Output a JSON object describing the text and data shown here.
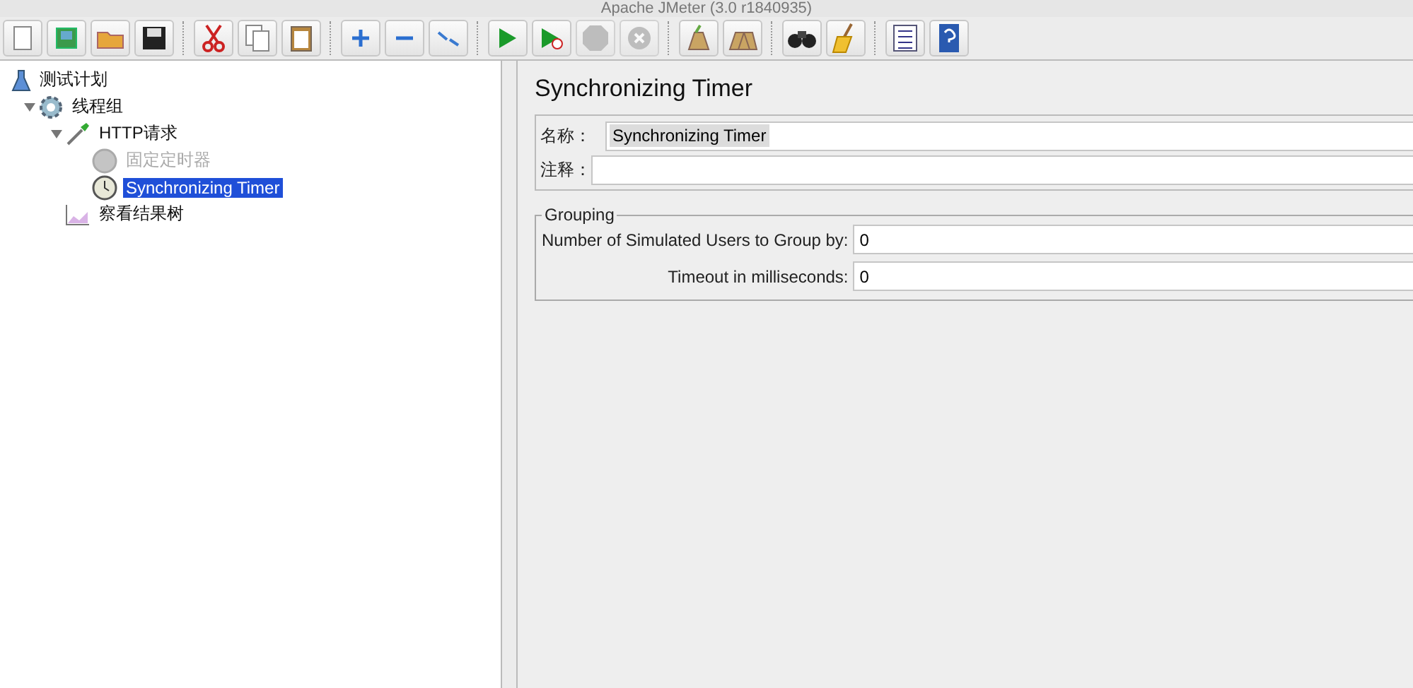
{
  "window": {
    "title": "Apache JMeter (3.0 r1840935)"
  },
  "toolbar": [
    {
      "kind": "new",
      "disabled": false
    },
    {
      "kind": "templates",
      "disabled": false
    },
    {
      "kind": "open",
      "disabled": false
    },
    {
      "kind": "save",
      "disabled": false
    },
    {
      "kind": "sep"
    },
    {
      "kind": "cut",
      "disabled": false
    },
    {
      "kind": "copy",
      "disabled": false
    },
    {
      "kind": "paste",
      "disabled": false
    },
    {
      "kind": "sep"
    },
    {
      "kind": "expand",
      "disabled": false
    },
    {
      "kind": "collapse",
      "disabled": false
    },
    {
      "kind": "toggle",
      "disabled": false
    },
    {
      "kind": "sep"
    },
    {
      "kind": "start",
      "disabled": false
    },
    {
      "kind": "start-no-pause",
      "disabled": false
    },
    {
      "kind": "stop",
      "disabled": true
    },
    {
      "kind": "shutdown",
      "disabled": true
    },
    {
      "kind": "sep"
    },
    {
      "kind": "clear",
      "disabled": false
    },
    {
      "kind": "clear-all",
      "disabled": false
    },
    {
      "kind": "sep"
    },
    {
      "kind": "search",
      "disabled": false
    },
    {
      "kind": "reset-search",
      "disabled": false
    },
    {
      "kind": "sep"
    },
    {
      "kind": "function",
      "disabled": false
    },
    {
      "kind": "help",
      "disabled": false
    }
  ],
  "tree": [
    {
      "label": "测试计划",
      "kind": "plan",
      "disabled": false,
      "selected": false,
      "children": [
        {
          "label": "线程组",
          "kind": "threads",
          "expanded": true,
          "disabled": false,
          "selected": false,
          "children": [
            {
              "label": "HTTP请求",
              "kind": "sampler",
              "expanded": true,
              "disabled": false,
              "selected": false,
              "children": [
                {
                  "label": "固定定时器",
                  "kind": "timer",
                  "disabled": true,
                  "selected": false
                },
                {
                  "label": "Synchronizing Timer",
                  "kind": "timer",
                  "disabled": false,
                  "selected": true
                }
              ]
            },
            {
              "label": "察看结果树",
              "kind": "listener",
              "disabled": false,
              "selected": false
            }
          ]
        }
      ]
    }
  ],
  "panel": {
    "title": "Synchronizing Timer",
    "name": {
      "label": "名称：",
      "value": "Synchronizing Timer"
    },
    "comment": {
      "label": "注释："
    },
    "group": {
      "title": "Grouping",
      "fields": [
        {
          "label": "Number of Simulated Users to Group by:",
          "value": "0"
        },
        {
          "label": "Timeout in milliseconds:",
          "value": "0"
        }
      ]
    }
  }
}
